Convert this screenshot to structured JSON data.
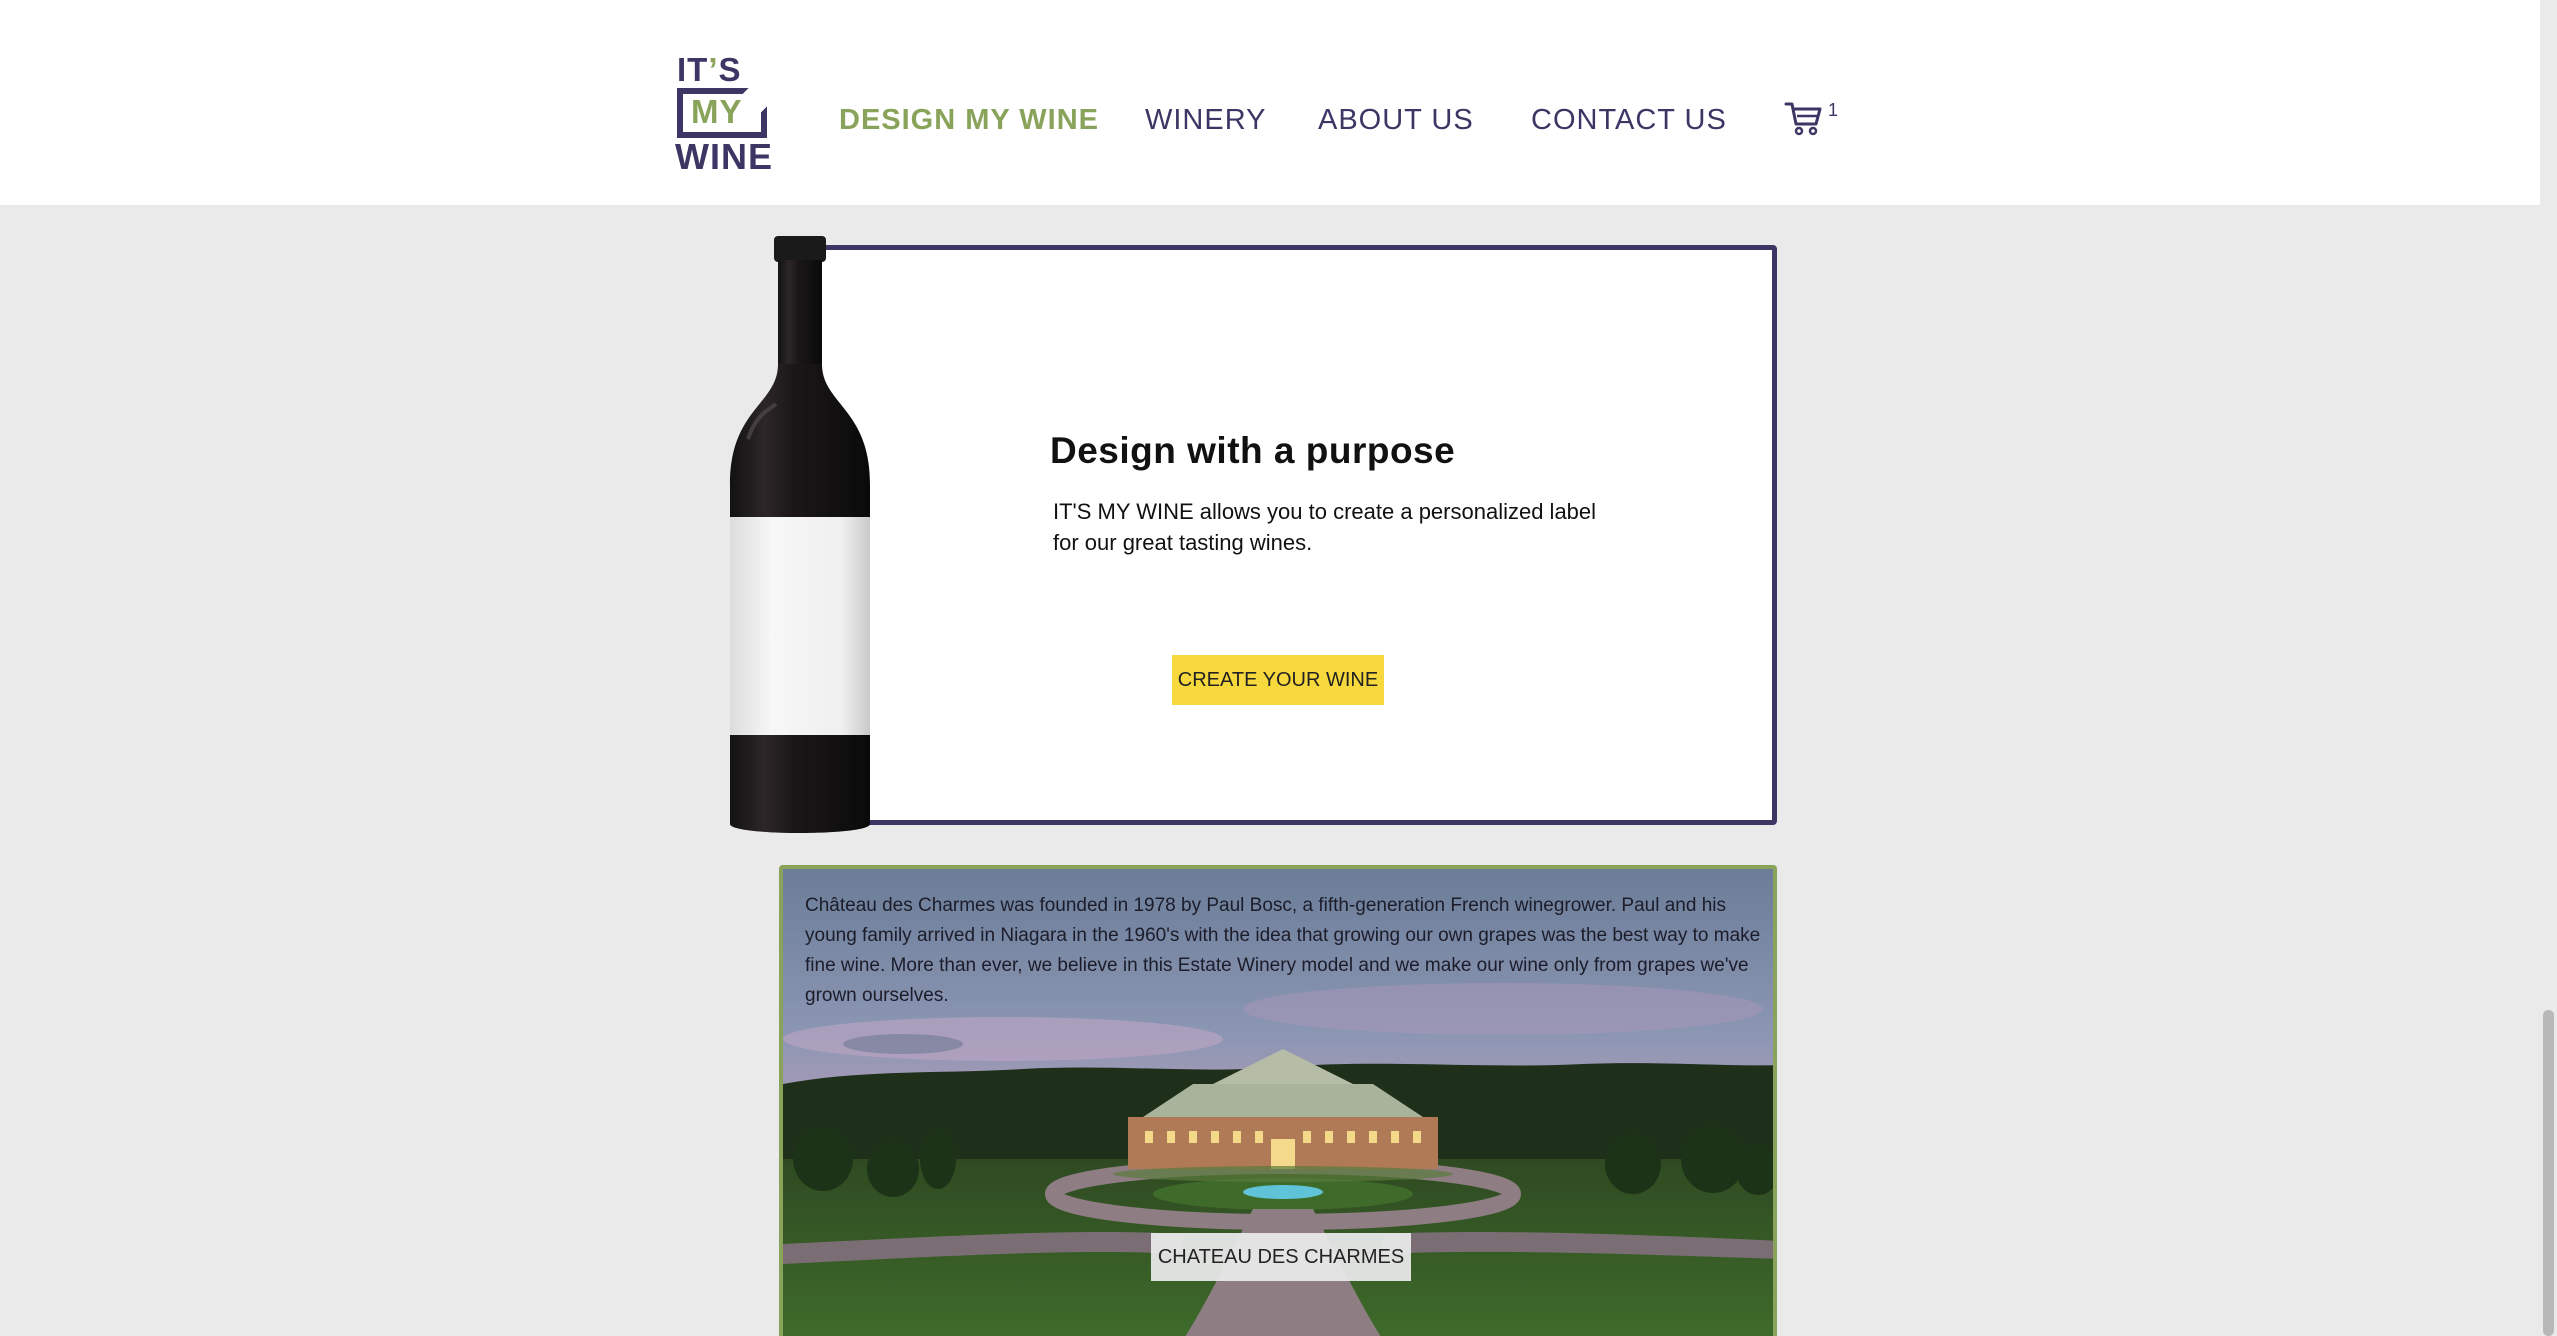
{
  "logo": {
    "line1_its": "IT",
    "line1_apos": "’",
    "line1_s": "S",
    "line2": "MY",
    "line3": "WINE"
  },
  "nav": {
    "items": [
      {
        "label": "DESIGN MY WINE",
        "active": true
      },
      {
        "label": "WINERY",
        "active": false
      },
      {
        "label": "ABOUT US",
        "active": false
      },
      {
        "label": "CONTACT US",
        "active": false
      }
    ],
    "cart_icon": "cart-icon",
    "cart_count": "1"
  },
  "hero": {
    "title": "Design with a purpose",
    "text": "IT'S MY WINE allows you to create a personalized label for our great tasting wines.",
    "cta_label": "CREATE YOUR WINE"
  },
  "winery": {
    "text": "Château des Charmes was founded in 1978 by Paul Bosc, a fifth-generation French winegrower. Paul and his young family arrived in Niagara in the 1960's with the idea that growing our own grapes was the best way to make fine wine. More than ever, we believe in this Estate Winery model and we make our wine only from grapes we've grown ourselves.",
    "label": "CHATEAU DES CHARMES"
  },
  "colors": {
    "brand_purple": "#3d3563",
    "brand_green": "#8aa35a",
    "cta_yellow": "#f7d93e",
    "page_bg": "#eaeaea"
  }
}
